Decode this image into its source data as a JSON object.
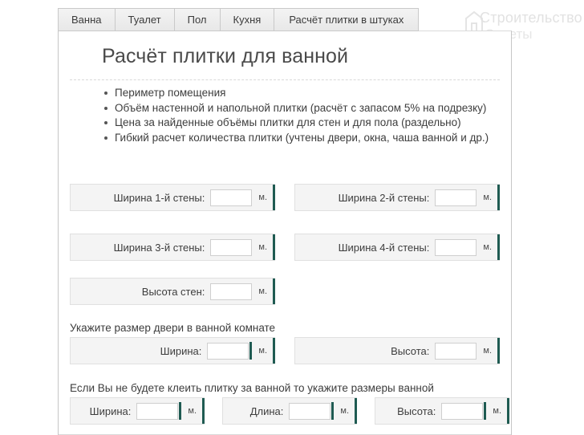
{
  "watermark": {
    "line1": "Строительство",
    "line2": "Советы",
    "logo_icon": "house-logo-icon"
  },
  "tabs": [
    {
      "label": "Ванна"
    },
    {
      "label": "Туалет"
    },
    {
      "label": "Пол"
    },
    {
      "label": "Кухня"
    },
    {
      "label": "Расчёт плитки в штуках"
    }
  ],
  "page_title": "Расчёт плитки для ванной",
  "features": [
    "Периметр помещения",
    "Объём настенной и напольной плитки (расчёт с запасом 5% на подрезку)",
    "Цена за найденные объёмы плитки для стен и для пола (раздельно)",
    "Гибкий расчет количества плитки (учтены двери, окна, чаша ванной и др.)"
  ],
  "unit": "м.",
  "walls": {
    "wall1_label": "Ширина 1-й стены:",
    "wall1_value": "",
    "wall2_label": "Ширина 2-й стены:",
    "wall2_value": "",
    "wall3_label": "Ширина 3-й стены:",
    "wall3_value": "",
    "wall4_label": "Ширина 4-й стены:",
    "wall4_value": "",
    "height_label": "Высота стен:",
    "height_value": ""
  },
  "door": {
    "note": "Укажите размер двери в ванной комнате",
    "width_label": "Ширина:",
    "width_value": "",
    "height_label": "Высота:",
    "height_value": ""
  },
  "bath": {
    "note": "Если Вы не будете клеить плитку за ванной то укажите размеры ванной",
    "width_label": "Ширина:",
    "width_value": "",
    "length_label": "Длина:",
    "length_value": "",
    "height_label": "Высота:",
    "height_value": ""
  },
  "colors": {
    "accent": "#1f5b52",
    "field_bg": "#f4f4f4",
    "tab_bg": "#eeeeee"
  }
}
